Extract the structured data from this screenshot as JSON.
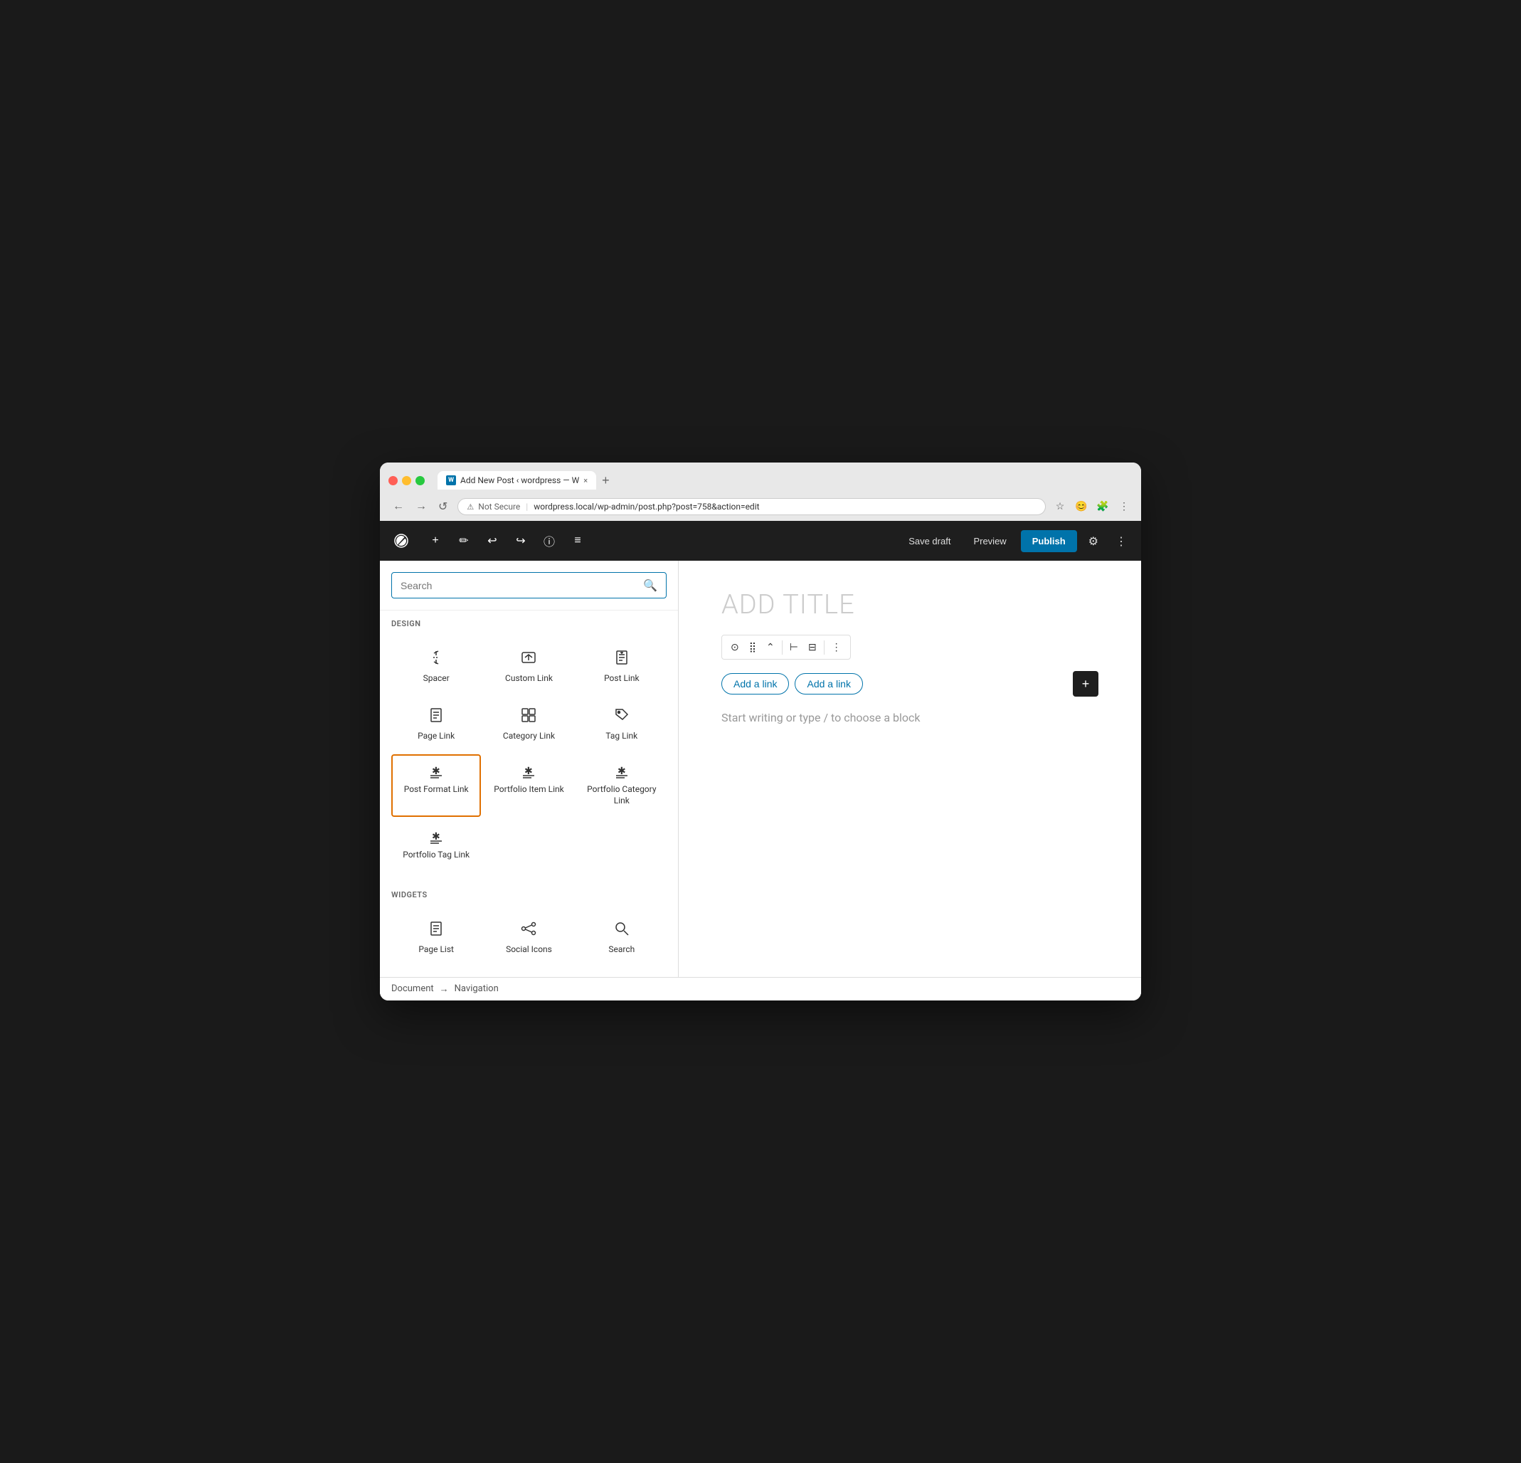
{
  "browser": {
    "tab_title": "Add New Post ‹ wordpress — W",
    "tab_close": "×",
    "new_tab": "+",
    "nav_back": "←",
    "nav_forward": "→",
    "nav_refresh": "↺",
    "security_label": "Not Secure",
    "url": "wordpress.local/wp-admin/post.php?post=758&action=edit",
    "bookmark_icon": "☆",
    "browser_more": "⋮"
  },
  "toolbar": {
    "save_draft_label": "Save draft",
    "preview_label": "Preview",
    "publish_label": "Publish",
    "undo_icon": "undo",
    "redo_icon": "redo",
    "info_icon": "info",
    "list_icon": "list"
  },
  "sidebar": {
    "search_placeholder": "Search",
    "sections": [
      {
        "label": "DESIGN",
        "blocks": [
          {
            "id": "spacer",
            "label": "Spacer",
            "icon_type": "spacer"
          },
          {
            "id": "custom-link",
            "label": "Custom Link",
            "icon_type": "custom-link"
          },
          {
            "id": "post-link",
            "label": "Post Link",
            "icon_type": "post-link"
          },
          {
            "id": "page-link",
            "label": "Page Link",
            "icon_type": "page-link"
          },
          {
            "id": "category-link",
            "label": "Category Link",
            "icon_type": "category-link"
          },
          {
            "id": "tag-link",
            "label": "Tag Link",
            "icon_type": "tag-link"
          },
          {
            "id": "post-format-link",
            "label": "Post Format Link",
            "icon_type": "star",
            "selected": true
          },
          {
            "id": "portfolio-item-link",
            "label": "Portfolio Item Link",
            "icon_type": "star"
          },
          {
            "id": "portfolio-category-link",
            "label": "Portfolio Category Link",
            "icon_type": "star"
          },
          {
            "id": "portfolio-tag-link",
            "label": "Portfolio Tag Link",
            "icon_type": "star"
          }
        ]
      },
      {
        "label": "WIDGETS",
        "blocks": [
          {
            "id": "page-list",
            "label": "Page List",
            "icon_type": "page-list"
          },
          {
            "id": "social-icons",
            "label": "Social Icons",
            "icon_type": "social-icons"
          },
          {
            "id": "search-widget",
            "label": "Search",
            "icon_type": "search"
          }
        ]
      }
    ]
  },
  "editor": {
    "title_placeholder": "ADD TITLE",
    "add_link_1": "Add a link",
    "add_link_2": "Add a link",
    "placeholder_text": "Start writing or type / to choose a block"
  },
  "footer": {
    "breadcrumb_parts": [
      "Document",
      "→",
      "Navigation"
    ]
  },
  "colors": {
    "accent_blue": "#0073aa",
    "selected_orange": "#e07000",
    "wp_dark": "#1e1e1e"
  }
}
